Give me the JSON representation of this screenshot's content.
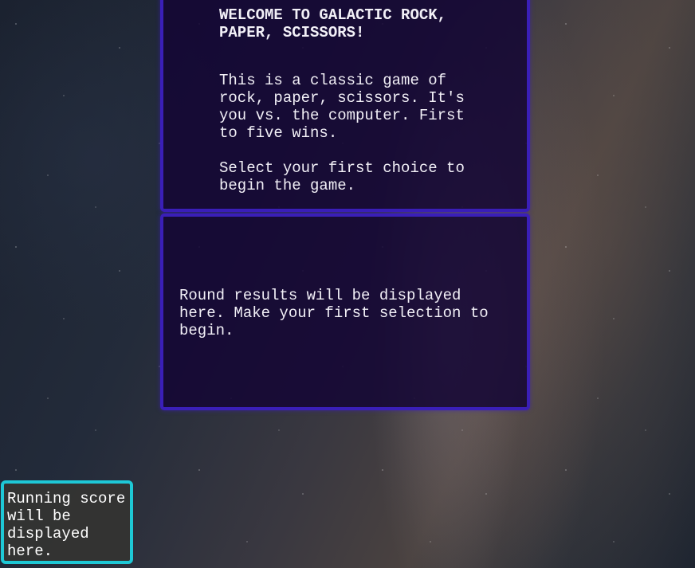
{
  "welcome": {
    "title": "WELCOME TO GALACTIC ROCK,\nPAPER, SCISSORS!",
    "description": "This is a classic game of\nrock, paper, scissors. It's\nyou vs. the computer. First\nto five wins.",
    "instruction": "Select your first choice to\nbegin the game."
  },
  "results": {
    "message": "Round results will be displayed here. Make your first selection to begin."
  },
  "score": {
    "message": "Running score will be displayed here."
  },
  "colors": {
    "panel_border": "#3a1fb8",
    "panel_background": "#14063a",
    "score_border": "#1ec8d6",
    "score_background": "#343432"
  }
}
